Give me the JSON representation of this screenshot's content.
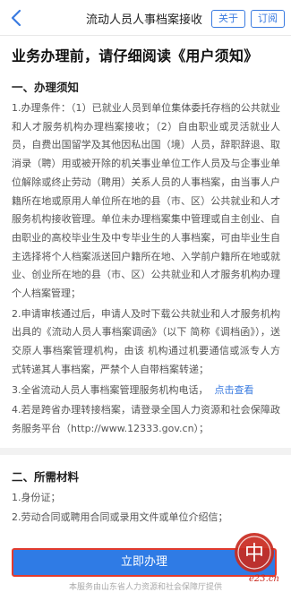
{
  "nav": {
    "title": "流动人员人事档案接收",
    "about": "关于",
    "subscribe": "订阅"
  },
  "content": {
    "main_title": "业务办理前，请仔细阅读《用户须知》",
    "section1_title": "一、办理须知",
    "p1": "1.办理条件：（1）已就业人员到单位集体委托存档的公共就业和人才服务机构办理档案接收；（2）自由职业或灵活就业人员，自费出国留学及其他因私出国（境）人员，辞职辞退、取消录（聘）用或被开除的机关事业单位工作人员及与企事业单位解除或终止劳动（聘用）关系人员的人事档案，由当事人户籍所在地或原用人单位所在地的县（市、区）公共就业和人才服务机构接收管理。单位未办理档案集中管理或自主创业、自由职业的高校毕业生及中专毕业生的人事档案，可由毕业生自主选择将个人档案派送回户籍所在地、入学前户籍所在地或就业、创业所在地的县（市、区）公共就业和人才服务机构办理个人档案管理；",
    "p2": "2.申请审核通过后，申请人及时下载公共就业和人才服务机构出具的《流动人员人事档案调函》（以下 简称《调档函》），送交原人事档案管理机构，由该 机构通过机要通信或派专人方式转递其人事档案，严禁个人自带档案转递；",
    "p3_text": "3.全省流动人员人事档案管理服务机构电话，",
    "p3_link": "点击查看",
    "p4": "4.若是跨省办理转接档案，请登录全国人力资源和社会保障政务服务平台（http://www.12333.gov.cn）；",
    "section2_title": "二、所需材料",
    "m1": "1.身份证；",
    "m2": "2.劳动合同或聘用合同或录用文件或单位介绍信；"
  },
  "cta": "立即办理",
  "footer": "本服务由山东省人力资源和社会保障厅提供",
  "watermark": {
    "stamp_char": "中",
    "site": "e23.cn"
  },
  "colors": {
    "accent": "#2f7be5",
    "stamp": "#c92a1f"
  }
}
